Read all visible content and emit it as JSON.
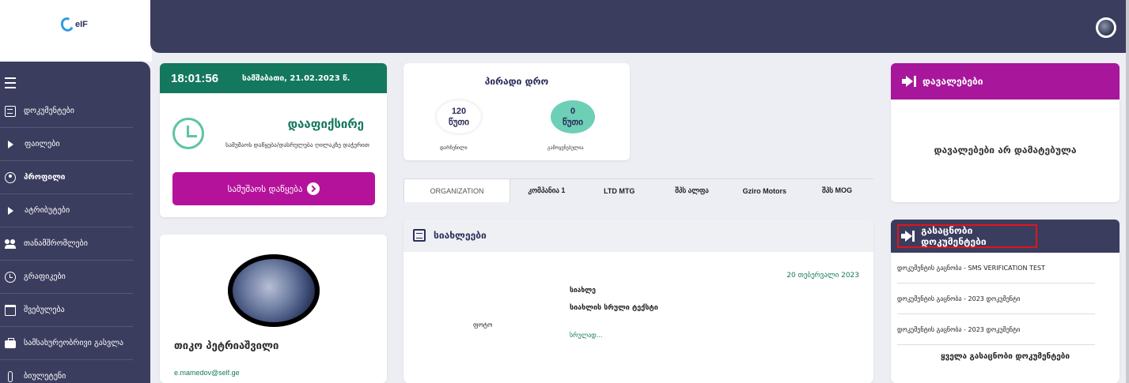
{
  "brand": {
    "logo_text": "eIF"
  },
  "sidebar": {
    "items": [
      {
        "label": "დოკუმენტები",
        "icon": "document-icon",
        "bold": false
      },
      {
        "label": "ფაილები",
        "icon": "triangle-right-icon",
        "bold": false
      },
      {
        "label": "პროფილი",
        "icon": "user-icon",
        "bold": true
      },
      {
        "label": "ატრიბუტები",
        "icon": "triangle-right-icon",
        "bold": false
      },
      {
        "label": "თანამშრომლები",
        "icon": "team-icon",
        "bold": false
      },
      {
        "label": "გრაფიკები",
        "icon": "clock-icon",
        "bold": false
      },
      {
        "label": "შვებულება",
        "icon": "calendar-icon",
        "bold": false
      },
      {
        "label": "სამსახურეობრივი გასვლა",
        "icon": "briefcase-icon",
        "bold": false
      },
      {
        "label": "ბიულეტენი",
        "icon": "thermometer-icon",
        "bold": false
      }
    ]
  },
  "clock_card": {
    "time": "18:01:56",
    "date": "სამშაბათი, 21.02.2023 წ.",
    "title": "დააფიქსირე",
    "subtitle": "სამუშაოს დაწყება/დასრულება ღილაკზე დაჭერით",
    "button_label": "სამუშაოს დაწყება"
  },
  "profile": {
    "name": "თიკო პეტრიაშვილი",
    "email": "e.mamedov@self.ge"
  },
  "personal_time": {
    "title": "პირადი დრო",
    "remaining_value": "120",
    "remaining_unit": "წუთი",
    "remaining_label": "დარჩენილი",
    "used_value": "0",
    "used_unit": "წუთი",
    "used_label": "გამოყენებულია"
  },
  "tabs": [
    {
      "label": "ORGANIZATION",
      "active": true
    },
    {
      "label": "კომპანია 1",
      "active": false
    },
    {
      "label": "LTD MTG",
      "active": false
    },
    {
      "label": "შპს ალფა",
      "active": false
    },
    {
      "label": "Gziro Motors",
      "active": false
    },
    {
      "label": "შპს MOG",
      "active": false
    }
  ],
  "news": {
    "title": "სიახლეები",
    "date": "20 თებერვალი 2023",
    "heading": "სიახლე",
    "full_text": "სიახლის სრული ტექსტი",
    "photo_label": "ფოტო",
    "more_link": "სრულად..."
  },
  "tasks": {
    "title": "დავალებები",
    "empty_text": "დავალებები არ დამატებულა"
  },
  "ack_docs": {
    "title": "გასაცნობი დოკუმენტები",
    "items": [
      "დოკუმენტის გაცნობა - SMS VERIFICATION TEST",
      "დოკუმენტის გაცნობა - 2023 დოკუმენტი",
      "დოკუმენტის გაცნობა - 2023 დოკუმენტი"
    ],
    "all_link": "ყველა გასაცნობი დოკუმენტები"
  },
  "colors": {
    "sidebar": "#3b3d5e",
    "green": "#13785e",
    "magenta": "#b5129b",
    "highlight_red": "#e3141a"
  }
}
